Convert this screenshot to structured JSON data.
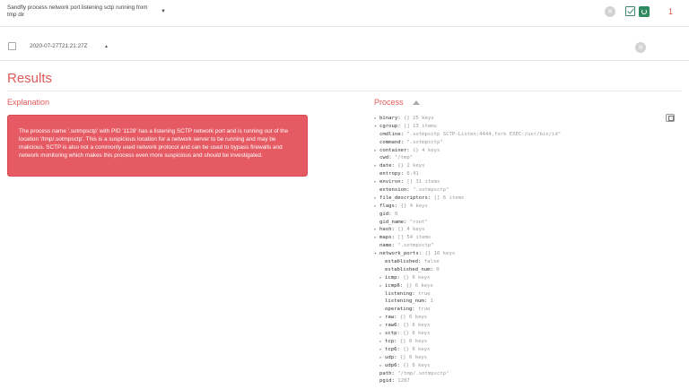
{
  "header": {
    "alert_title": "Sandfly process network port listening sctp running from tmp dir",
    "count": "1"
  },
  "row": {
    "timestamp": "2020-07-27T21:21:27Z"
  },
  "results_title": "Results",
  "explanation": {
    "title": "Explanation",
    "text": "The process name '.sotmpsctp' with PID '1128' has a listening SCTP network port and is running out of the location '/tmp/.sotmpsctp'. This is a suspicious location for a network server to be running and may be malicious. SCTP is also not a commonly used network protocol and can be used to bypass firewalls and network monitoring which makes this process even more suspicious and should be investigated."
  },
  "process": {
    "title": "Process",
    "tree": [
      {
        "indent": 0,
        "arrow": "▸",
        "key": "binary:",
        "val": "{} 25 keys"
      },
      {
        "indent": 0,
        "arrow": "▾",
        "key": "cgroup:",
        "val": "[] 13 items"
      },
      {
        "indent": 0,
        "arrow": "",
        "key": "cmdline:",
        "val": "\".sotmpsctp SCTP-Listen:4444,fork EXEC:/usr/bin/id\""
      },
      {
        "indent": 0,
        "arrow": "",
        "key": "command:",
        "val": "\".sotmpsctp\""
      },
      {
        "indent": 0,
        "arrow": "▸",
        "key": "container:",
        "val": "{} 4 keys"
      },
      {
        "indent": 0,
        "arrow": "",
        "key": "cwd:",
        "val": "\"/tmp\""
      },
      {
        "indent": 0,
        "arrow": "▸",
        "key": "date:",
        "val": "{} 2 keys"
      },
      {
        "indent": 0,
        "arrow": "",
        "key": "entropy:",
        "val": "6.41"
      },
      {
        "indent": 0,
        "arrow": "▸",
        "key": "environ:",
        "val": "[] 31 items"
      },
      {
        "indent": 0,
        "arrow": "",
        "key": "extension:",
        "val": "\".sotmpsctp\""
      },
      {
        "indent": 0,
        "arrow": "▸",
        "key": "file_descriptors:",
        "val": "[] 6 items"
      },
      {
        "indent": 0,
        "arrow": "▸",
        "key": "flags:",
        "val": "{} 4 keys"
      },
      {
        "indent": 0,
        "arrow": "",
        "key": "gid:",
        "val": "0"
      },
      {
        "indent": 0,
        "arrow": "",
        "key": "gid_name:",
        "val": "\"root\""
      },
      {
        "indent": 0,
        "arrow": "▸",
        "key": "hash:",
        "val": "{} 4 keys"
      },
      {
        "indent": 0,
        "arrow": "▸",
        "key": "maps:",
        "val": "[] 54 items"
      },
      {
        "indent": 0,
        "arrow": "",
        "key": "name:",
        "val": "\".sotmpsctp\""
      },
      {
        "indent": 0,
        "arrow": "▾",
        "key": "network_ports:",
        "val": "{} 16 keys"
      },
      {
        "indent": 1,
        "arrow": "",
        "key": "established:",
        "val": "false"
      },
      {
        "indent": 1,
        "arrow": "",
        "key": "established_num:",
        "val": "0"
      },
      {
        "indent": 1,
        "arrow": "▸",
        "key": "icmp:",
        "val": "{} 6 keys"
      },
      {
        "indent": 1,
        "arrow": "▸",
        "key": "icmp6:",
        "val": "{} 6 keys"
      },
      {
        "indent": 1,
        "arrow": "",
        "key": "listening:",
        "val": "true"
      },
      {
        "indent": 1,
        "arrow": "",
        "key": "listening_num:",
        "val": "1"
      },
      {
        "indent": 1,
        "arrow": "",
        "key": "operating:",
        "val": "true"
      },
      {
        "indent": 1,
        "arrow": "▸",
        "key": "raw:",
        "val": "{} 6 keys"
      },
      {
        "indent": 1,
        "arrow": "▸",
        "key": "raw6:",
        "val": "{} 6 keys"
      },
      {
        "indent": 1,
        "arrow": "▸",
        "key": "sctp:",
        "val": "{} 6 keys"
      },
      {
        "indent": 1,
        "arrow": "▸",
        "key": "tcp:",
        "val": "{} 6 keys"
      },
      {
        "indent": 1,
        "arrow": "▸",
        "key": "tcp6:",
        "val": "{} 6 keys"
      },
      {
        "indent": 1,
        "arrow": "▸",
        "key": "udp:",
        "val": "{} 6 keys"
      },
      {
        "indent": 1,
        "arrow": "▸",
        "key": "udp6:",
        "val": "{} 6 keys"
      },
      {
        "indent": 0,
        "arrow": "",
        "key": "path:",
        "val": "\"/tmp/.sotmpsctp\""
      },
      {
        "indent": 0,
        "arrow": "",
        "key": "pgid:",
        "val": "1287"
      }
    ]
  },
  "icons": {
    "acknowledge": "close-circle-icon",
    "whitelist": "checkbox-pencil-icon",
    "refresh": "refresh-icon",
    "row_close": "close-circle-icon",
    "copy": "copy-icon"
  },
  "colors": {
    "accent": "#e05a5a",
    "explanation_bg": "#e55a63",
    "success": "#2f8a5f"
  }
}
